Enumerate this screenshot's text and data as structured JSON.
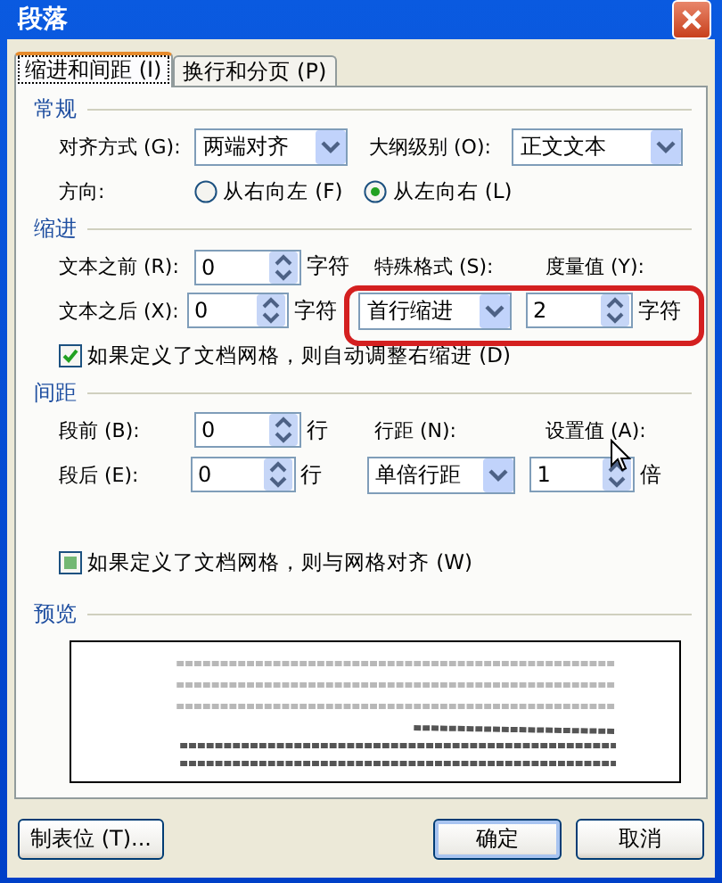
{
  "window": {
    "title": "段落"
  },
  "tabs": [
    {
      "label": "缩进和间距 (I)",
      "selected": true
    },
    {
      "label": "换行和分页 (P)",
      "selected": false
    }
  ],
  "general": {
    "title": "常规",
    "alignment": {
      "label": "对齐方式 (G):",
      "value": "两端对齐"
    },
    "outline_level": {
      "label": "大纲级别 (O):",
      "value": "正文文本"
    },
    "direction": {
      "label": "方向:",
      "options": [
        {
          "label": "从右向左 (F)",
          "selected": false
        },
        {
          "label": "从左向右 (L)",
          "selected": true
        }
      ]
    }
  },
  "indent": {
    "title": "缩进",
    "before": {
      "label": "文本之前 (R):",
      "value": "0",
      "unit": "字符"
    },
    "after": {
      "label": "文本之后 (X):",
      "value": "0",
      "unit": "字符"
    },
    "special": {
      "label": "特殊格式 (S):",
      "value": "首行缩进"
    },
    "amount": {
      "label": "度量值 (Y):",
      "value": "2",
      "unit": "字符"
    },
    "auto_adjust": {
      "label": "如果定义了文档网格，则自动调整右缩进 (D)",
      "checked": true
    }
  },
  "spacing": {
    "title": "间距",
    "before": {
      "label": "段前 (B):",
      "value": "0",
      "unit": "行"
    },
    "after": {
      "label": "段后 (E):",
      "value": "0",
      "unit": "行"
    },
    "line_spacing": {
      "label": "行距 (N):",
      "value": "单倍行距"
    },
    "setting": {
      "label": "设置值 (A):",
      "value": "1",
      "unit": "倍"
    },
    "snap_to_grid": {
      "label": "如果定义了文档网格，则与网格对齐 (W)",
      "checked": false,
      "indeterminate": true
    }
  },
  "preview": {
    "title": "预览"
  },
  "buttons": [
    {
      "label": "制表位 (T)...",
      "default": false
    },
    {
      "label": "确定",
      "default": true
    },
    {
      "label": "取消",
      "default": false
    }
  ]
}
